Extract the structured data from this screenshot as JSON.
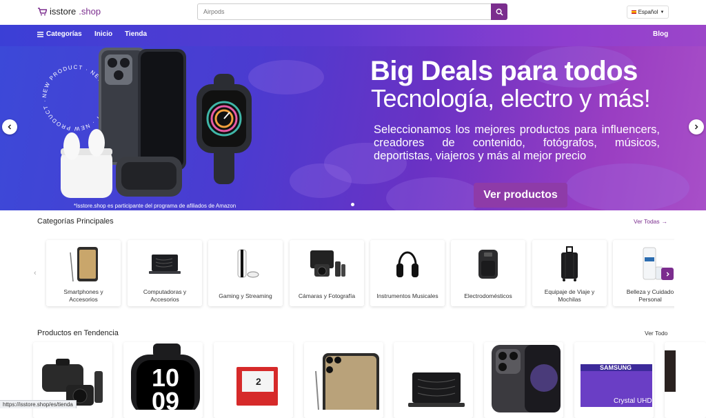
{
  "header": {
    "brand": "isstore",
    "tld": ".shop",
    "search_placeholder": "Airpods",
    "language": "Español"
  },
  "nav": {
    "categories_label": "Categorías",
    "home_label": "Inicio",
    "shop_label": "Tienda",
    "blog_label": "Blog"
  },
  "hero": {
    "title": "Big Deals para todos",
    "subtitle": "Tecnología, electro y más!",
    "description": "Seleccionamos los mejores productos para influencers, creadores de contenido, fotógrafos, músicos, deportistas, viajeros y más al mejor precio",
    "cta": "Ver productos",
    "disclaimer": "*Isstore.shop es participante del programa de afiliados de Amazon",
    "seal_text": "NEW PRODUCT · NEW PRODUCT · NEW PRODUCT ·"
  },
  "categories": {
    "title": "Categorías Principales",
    "see_all": "Ver Todas",
    "items": [
      {
        "label": "Smartphones y Accesorios",
        "icon": "smartphone-icon"
      },
      {
        "label": "Computadoras y Accesorios",
        "icon": "laptop-icon"
      },
      {
        "label": "Gaming y Streaming",
        "icon": "console-icon"
      },
      {
        "label": "Cámaras y Fotografía",
        "icon": "camera-icon"
      },
      {
        "label": "Instrumentos Musicales",
        "icon": "headphones-icon"
      },
      {
        "label": "Electrodomésticos",
        "icon": "air-fryer-icon"
      },
      {
        "label": "Equipaje de Viaje y Mochilas",
        "icon": "suitcase-icon"
      },
      {
        "label": "Belleza y Cuidado Personal",
        "icon": "cosmetics-icon"
      }
    ]
  },
  "trending": {
    "title": "Productos en Tendencia",
    "see_all": "Ver Todo",
    "items": [
      {
        "icon": "camera-kit-icon"
      },
      {
        "icon": "smartwatch-icon",
        "text": "10 09"
      },
      {
        "icon": "console-box-icon",
        "text": "2"
      },
      {
        "icon": "smartphone-icon"
      },
      {
        "icon": "laptop-icon"
      },
      {
        "icon": "iphone-icon"
      },
      {
        "icon": "tv-icon",
        "brand": "SAMSUNG",
        "text": "Crystal UHD"
      }
    ]
  },
  "status_bar": {
    "url": "https://isstore.shop/es/tienda"
  },
  "colors": {
    "brand": "#7b2d8e",
    "nav_start": "#3b3fd6",
    "nav_end": "#9c46c9"
  }
}
